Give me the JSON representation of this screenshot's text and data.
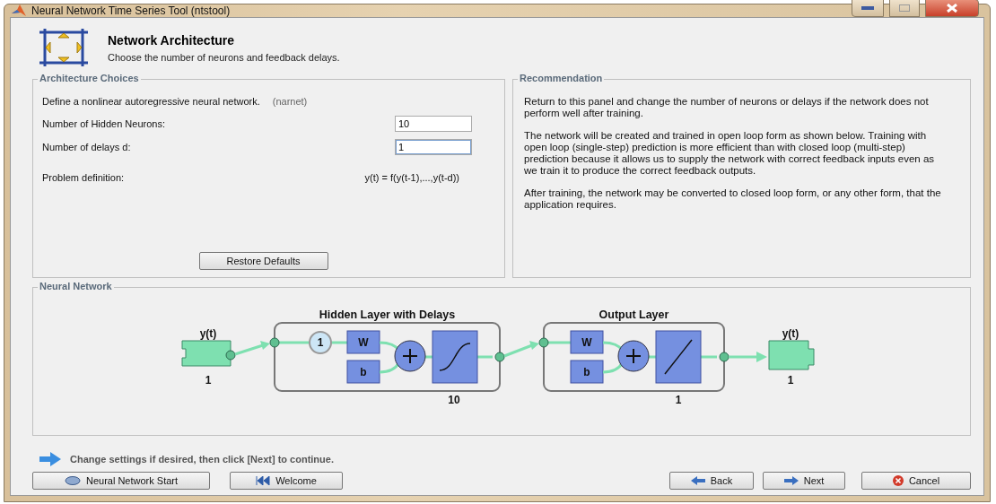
{
  "window": {
    "title": "Neural Network Time Series Tool (ntstool)"
  },
  "header": {
    "title": "Network Architecture",
    "subtitle": "Choose the number of neurons and feedback delays."
  },
  "architecture": {
    "title": "Architecture Choices",
    "intro": "Define a nonlinear autoregressive neural network.",
    "intro_note": "(narnet)",
    "fields": [
      {
        "label": "Number of Hidden Neurons:",
        "value": "10",
        "focused": false
      },
      {
        "label": "Number of delays d:",
        "value": "1",
        "focused": true
      }
    ],
    "problem": {
      "label": "Problem definition:",
      "formula": "y(t) = f(y(t-1),...,y(t-d))"
    },
    "restore_button": "Restore Defaults"
  },
  "recommendation": {
    "title": "Recommendation",
    "paragraphs": [
      "Return to this panel and change the number of neurons or delays if the network does not perform well after training.",
      "The network will be created and trained in open loop form as shown below. Training with open loop (single-step) prediction is more efficient than with closed loop (multi-step) prediction because it allows us to supply the network with correct feedback inputs even as we train it to produce the correct feedback outputs.",
      "After training, the network may be converted to closed loop form, or any other form, that the application requires."
    ]
  },
  "network": {
    "title": "Neural Network",
    "input": {
      "label": "y(t)",
      "size": "1"
    },
    "hidden": {
      "title": "Hidden Layer with Delays",
      "delay": "1",
      "weight": "W",
      "bias": "b",
      "size": "10"
    },
    "output": {
      "title": "Output Layer",
      "weight": "W",
      "bias": "b",
      "size": "1"
    },
    "target": {
      "label": "y(t)",
      "size": "1"
    }
  },
  "hint": "Change settings  if desired, then click [Next] to continue.",
  "left_buttons": [
    {
      "label": "Neural Network Start",
      "kind": "start"
    },
    {
      "label": "Welcome",
      "kind": "welcome"
    }
  ],
  "right_buttons": [
    {
      "label": "Back",
      "kind": "back"
    },
    {
      "label": "Next",
      "kind": "next"
    },
    {
      "label": "Cancel",
      "kind": "cancel"
    }
  ]
}
